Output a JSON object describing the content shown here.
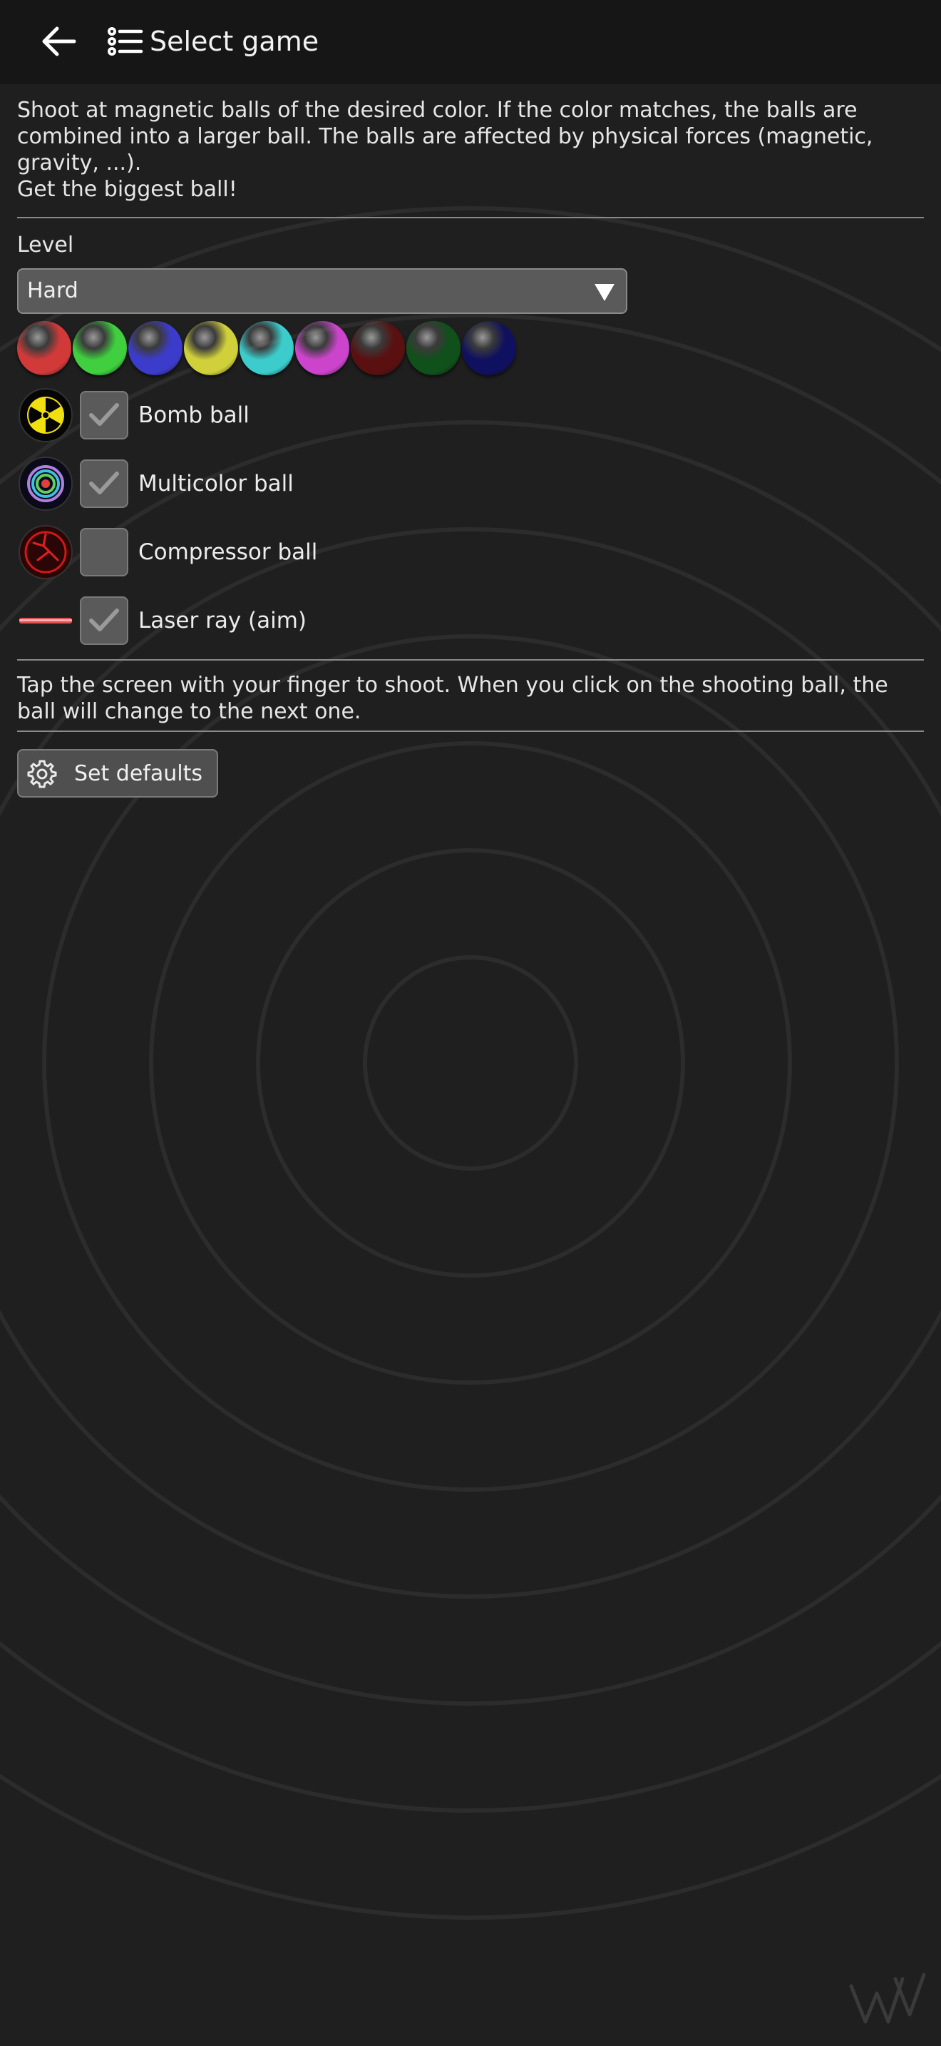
{
  "appbar": {
    "title": "Select game",
    "back_icon": "arrow-left-icon",
    "list_icon": "list-icon"
  },
  "description": {
    "text": "Shoot at magnetic balls of the desired color. If the color matches, the balls are combined into a larger ball. The balls are affected by physical forces (magnetic, gravity, ...).\nGet the biggest ball!"
  },
  "level": {
    "label": "Level",
    "selected": "Hard"
  },
  "ball_colors": [
    "#d23a3a",
    "#3fcf3f",
    "#3c3ccc",
    "#d0d03a",
    "#3ccccc",
    "#cc44cc",
    "#5a1010",
    "#10501a",
    "#101060"
  ],
  "options": [
    {
      "label": "Bomb ball",
      "checked": true,
      "icon": "radiation-icon"
    },
    {
      "label": "Multicolor ball",
      "checked": true,
      "icon": "multicolor-ball-icon"
    },
    {
      "label": "Compressor ball",
      "checked": false,
      "icon": "compressor-ball-icon"
    },
    {
      "label": "Laser ray (aim)",
      "checked": true,
      "icon": "laser-icon"
    }
  ],
  "hint": {
    "text": "Tap the screen with your finger to shoot. When you click on the shooting ball, the ball will change to the next one."
  },
  "defaults_button": {
    "label": "Set defaults",
    "icon": "gear-icon"
  }
}
